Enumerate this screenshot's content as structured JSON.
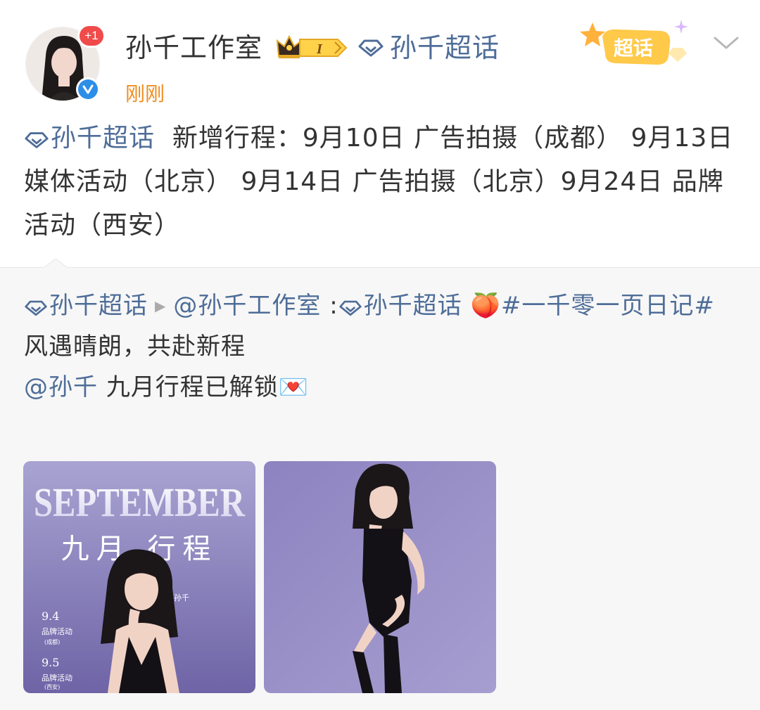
{
  "header": {
    "username": "孙千工作室",
    "plus_badge": "+1",
    "fan_level": "I",
    "topic_name": "孙千超话",
    "timestamp": "刚刚",
    "chaohua_label": "超话"
  },
  "post": {
    "topic": "孙千超话",
    "text": "新增行程：9月10日 广告拍摄（成都） 9月13日 媒体活动（北京） 9月14日 广告拍摄（北京）9月24日 品牌活动（西安）"
  },
  "repost": {
    "topic": "孙千超话",
    "author": "@孙千工作室",
    "separator": ":",
    "inner_topic": "孙千超话",
    "emoji": "🍑",
    "hashtag": "#一千零一页日记#",
    "line2": "风遇晴朗，共赴新程",
    "mention": "@孙千",
    "line3": "九月行程已解锁",
    "line3_emoji": "💌",
    "images": [
      {
        "title_en": "SEPTEMBER",
        "title_cn": "九月 行程",
        "side_text": "孙千",
        "schedule": [
          {
            "date": "9.4",
            "event": "品牌活动",
            "city": "(成都)"
          },
          {
            "date": "9.5",
            "event": "品牌活动",
            "city": "(西安)"
          }
        ]
      },
      {}
    ]
  },
  "colors": {
    "link": "#4e6d98",
    "timestamp": "#f08c1e",
    "badge_red": "#f04a4a",
    "verified_blue": "#2d8ee8",
    "repost_bg": "#f7f7f7",
    "photo_purple": "#7d74b2"
  },
  "icons": {
    "topic": "diamond-icon",
    "crown": "crown-icon",
    "verified": "verified-icon",
    "chevron": "chevron-down-icon",
    "play": "triangle-right-icon"
  }
}
